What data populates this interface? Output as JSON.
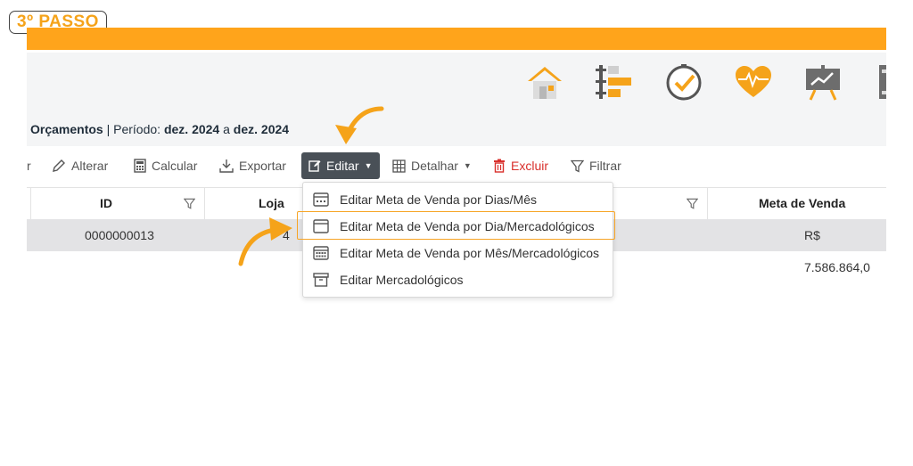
{
  "step_label": "3º PASSO",
  "title": {
    "module": "Orçamentos",
    "sep": "|",
    "period_label": "Período:",
    "from": "dez. 2024",
    "conj": "a",
    "to": "dez. 2024"
  },
  "toolbar": {
    "partial": "r",
    "alterar": "Alterar",
    "calcular": "Calcular",
    "exportar": "Exportar",
    "editar": "Editar",
    "detalhar": "Detalhar",
    "excluir": "Excluir",
    "filtrar": "Filtrar"
  },
  "table": {
    "headers": {
      "id": "ID",
      "loja": "Loja",
      "meta": "Meta de Venda"
    },
    "row": {
      "id": "0000000013",
      "loja_partial": "4",
      "meta": "R$ 7.586.864,0"
    }
  },
  "dropdown": {
    "items": [
      "Editar Meta de Venda por Dias/Mês",
      "Editar Meta de Venda por Dia/Mercadológicos",
      "Editar Meta de Venda por Mês/Mercadológicos",
      "Editar Mercadológicos"
    ]
  },
  "colors": {
    "accent": "#ffa41b",
    "editar_bg": "#495057",
    "excluir": "#d9302c"
  },
  "icons": [
    "home-icon",
    "hierarchy-icon",
    "clock-check-icon",
    "heart-pulse-icon",
    "chart-board-icon",
    "binder-icon"
  ]
}
